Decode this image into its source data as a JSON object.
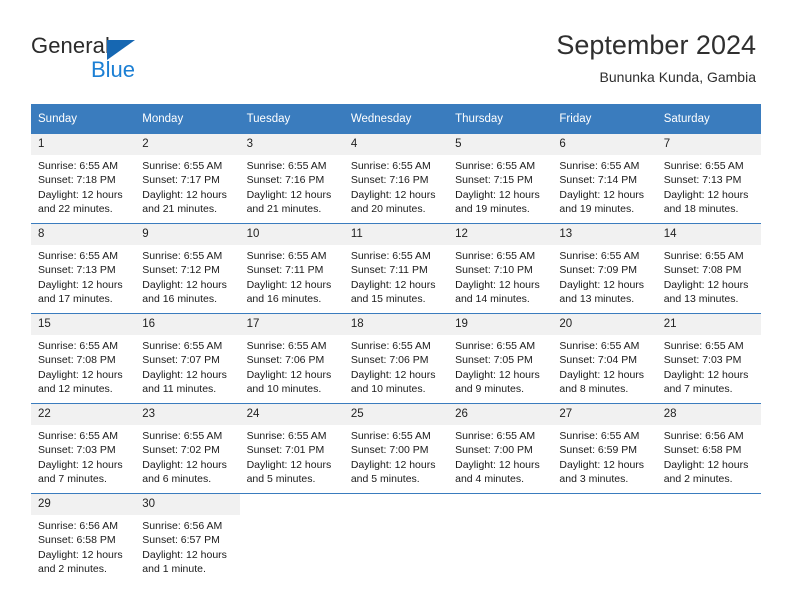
{
  "logo": {
    "primary_text": "General",
    "secondary_text": "Blue",
    "triangle_color": "#1667b2",
    "secondary_color": "#1b7fd4"
  },
  "header": {
    "title": "September 2024",
    "subtitle": "Bununka Kunda, Gambia"
  },
  "theme": {
    "header_blue": "#3a7cbe",
    "daynum_gray": "#f1f1f1"
  },
  "weekday_headers": [
    "Sunday",
    "Monday",
    "Tuesday",
    "Wednesday",
    "Thursday",
    "Friday",
    "Saturday"
  ],
  "weeks": [
    [
      {
        "day": "1",
        "sunrise": "Sunrise: 6:55 AM",
        "sunset": "Sunset: 7:18 PM",
        "daylight_line1": "Daylight: 12 hours",
        "daylight_line2": "and 22 minutes."
      },
      {
        "day": "2",
        "sunrise": "Sunrise: 6:55 AM",
        "sunset": "Sunset: 7:17 PM",
        "daylight_line1": "Daylight: 12 hours",
        "daylight_line2": "and 21 minutes."
      },
      {
        "day": "3",
        "sunrise": "Sunrise: 6:55 AM",
        "sunset": "Sunset: 7:16 PM",
        "daylight_line1": "Daylight: 12 hours",
        "daylight_line2": "and 21 minutes."
      },
      {
        "day": "4",
        "sunrise": "Sunrise: 6:55 AM",
        "sunset": "Sunset: 7:16 PM",
        "daylight_line1": "Daylight: 12 hours",
        "daylight_line2": "and 20 minutes."
      },
      {
        "day": "5",
        "sunrise": "Sunrise: 6:55 AM",
        "sunset": "Sunset: 7:15 PM",
        "daylight_line1": "Daylight: 12 hours",
        "daylight_line2": "and 19 minutes."
      },
      {
        "day": "6",
        "sunrise": "Sunrise: 6:55 AM",
        "sunset": "Sunset: 7:14 PM",
        "daylight_line1": "Daylight: 12 hours",
        "daylight_line2": "and 19 minutes."
      },
      {
        "day": "7",
        "sunrise": "Sunrise: 6:55 AM",
        "sunset": "Sunset: 7:13 PM",
        "daylight_line1": "Daylight: 12 hours",
        "daylight_line2": "and 18 minutes."
      }
    ],
    [
      {
        "day": "8",
        "sunrise": "Sunrise: 6:55 AM",
        "sunset": "Sunset: 7:13 PM",
        "daylight_line1": "Daylight: 12 hours",
        "daylight_line2": "and 17 minutes."
      },
      {
        "day": "9",
        "sunrise": "Sunrise: 6:55 AM",
        "sunset": "Sunset: 7:12 PM",
        "daylight_line1": "Daylight: 12 hours",
        "daylight_line2": "and 16 minutes."
      },
      {
        "day": "10",
        "sunrise": "Sunrise: 6:55 AM",
        "sunset": "Sunset: 7:11 PM",
        "daylight_line1": "Daylight: 12 hours",
        "daylight_line2": "and 16 minutes."
      },
      {
        "day": "11",
        "sunrise": "Sunrise: 6:55 AM",
        "sunset": "Sunset: 7:11 PM",
        "daylight_line1": "Daylight: 12 hours",
        "daylight_line2": "and 15 minutes."
      },
      {
        "day": "12",
        "sunrise": "Sunrise: 6:55 AM",
        "sunset": "Sunset: 7:10 PM",
        "daylight_line1": "Daylight: 12 hours",
        "daylight_line2": "and 14 minutes."
      },
      {
        "day": "13",
        "sunrise": "Sunrise: 6:55 AM",
        "sunset": "Sunset: 7:09 PM",
        "daylight_line1": "Daylight: 12 hours",
        "daylight_line2": "and 13 minutes."
      },
      {
        "day": "14",
        "sunrise": "Sunrise: 6:55 AM",
        "sunset": "Sunset: 7:08 PM",
        "daylight_line1": "Daylight: 12 hours",
        "daylight_line2": "and 13 minutes."
      }
    ],
    [
      {
        "day": "15",
        "sunrise": "Sunrise: 6:55 AM",
        "sunset": "Sunset: 7:08 PM",
        "daylight_line1": "Daylight: 12 hours",
        "daylight_line2": "and 12 minutes."
      },
      {
        "day": "16",
        "sunrise": "Sunrise: 6:55 AM",
        "sunset": "Sunset: 7:07 PM",
        "daylight_line1": "Daylight: 12 hours",
        "daylight_line2": "and 11 minutes."
      },
      {
        "day": "17",
        "sunrise": "Sunrise: 6:55 AM",
        "sunset": "Sunset: 7:06 PM",
        "daylight_line1": "Daylight: 12 hours",
        "daylight_line2": "and 10 minutes."
      },
      {
        "day": "18",
        "sunrise": "Sunrise: 6:55 AM",
        "sunset": "Sunset: 7:06 PM",
        "daylight_line1": "Daylight: 12 hours",
        "daylight_line2": "and 10 minutes."
      },
      {
        "day": "19",
        "sunrise": "Sunrise: 6:55 AM",
        "sunset": "Sunset: 7:05 PM",
        "daylight_line1": "Daylight: 12 hours",
        "daylight_line2": "and 9 minutes."
      },
      {
        "day": "20",
        "sunrise": "Sunrise: 6:55 AM",
        "sunset": "Sunset: 7:04 PM",
        "daylight_line1": "Daylight: 12 hours",
        "daylight_line2": "and 8 minutes."
      },
      {
        "day": "21",
        "sunrise": "Sunrise: 6:55 AM",
        "sunset": "Sunset: 7:03 PM",
        "daylight_line1": "Daylight: 12 hours",
        "daylight_line2": "and 7 minutes."
      }
    ],
    [
      {
        "day": "22",
        "sunrise": "Sunrise: 6:55 AM",
        "sunset": "Sunset: 7:03 PM",
        "daylight_line1": "Daylight: 12 hours",
        "daylight_line2": "and 7 minutes."
      },
      {
        "day": "23",
        "sunrise": "Sunrise: 6:55 AM",
        "sunset": "Sunset: 7:02 PM",
        "daylight_line1": "Daylight: 12 hours",
        "daylight_line2": "and 6 minutes."
      },
      {
        "day": "24",
        "sunrise": "Sunrise: 6:55 AM",
        "sunset": "Sunset: 7:01 PM",
        "daylight_line1": "Daylight: 12 hours",
        "daylight_line2": "and 5 minutes."
      },
      {
        "day": "25",
        "sunrise": "Sunrise: 6:55 AM",
        "sunset": "Sunset: 7:00 PM",
        "daylight_line1": "Daylight: 12 hours",
        "daylight_line2": "and 5 minutes."
      },
      {
        "day": "26",
        "sunrise": "Sunrise: 6:55 AM",
        "sunset": "Sunset: 7:00 PM",
        "daylight_line1": "Daylight: 12 hours",
        "daylight_line2": "and 4 minutes."
      },
      {
        "day": "27",
        "sunrise": "Sunrise: 6:55 AM",
        "sunset": "Sunset: 6:59 PM",
        "daylight_line1": "Daylight: 12 hours",
        "daylight_line2": "and 3 minutes."
      },
      {
        "day": "28",
        "sunrise": "Sunrise: 6:56 AM",
        "sunset": "Sunset: 6:58 PM",
        "daylight_line1": "Daylight: 12 hours",
        "daylight_line2": "and 2 minutes."
      }
    ],
    [
      {
        "day": "29",
        "sunrise": "Sunrise: 6:56 AM",
        "sunset": "Sunset: 6:58 PM",
        "daylight_line1": "Daylight: 12 hours",
        "daylight_line2": "and 2 minutes."
      },
      {
        "day": "30",
        "sunrise": "Sunrise: 6:56 AM",
        "sunset": "Sunset: 6:57 PM",
        "daylight_line1": "Daylight: 12 hours",
        "daylight_line2": "and 1 minute."
      },
      {
        "day": "",
        "sunrise": "",
        "sunset": "",
        "daylight_line1": "",
        "daylight_line2": ""
      },
      {
        "day": "",
        "sunrise": "",
        "sunset": "",
        "daylight_line1": "",
        "daylight_line2": ""
      },
      {
        "day": "",
        "sunrise": "",
        "sunset": "",
        "daylight_line1": "",
        "daylight_line2": ""
      },
      {
        "day": "",
        "sunrise": "",
        "sunset": "",
        "daylight_line1": "",
        "daylight_line2": ""
      },
      {
        "day": "",
        "sunrise": "",
        "sunset": "",
        "daylight_line1": "",
        "daylight_line2": ""
      }
    ]
  ]
}
